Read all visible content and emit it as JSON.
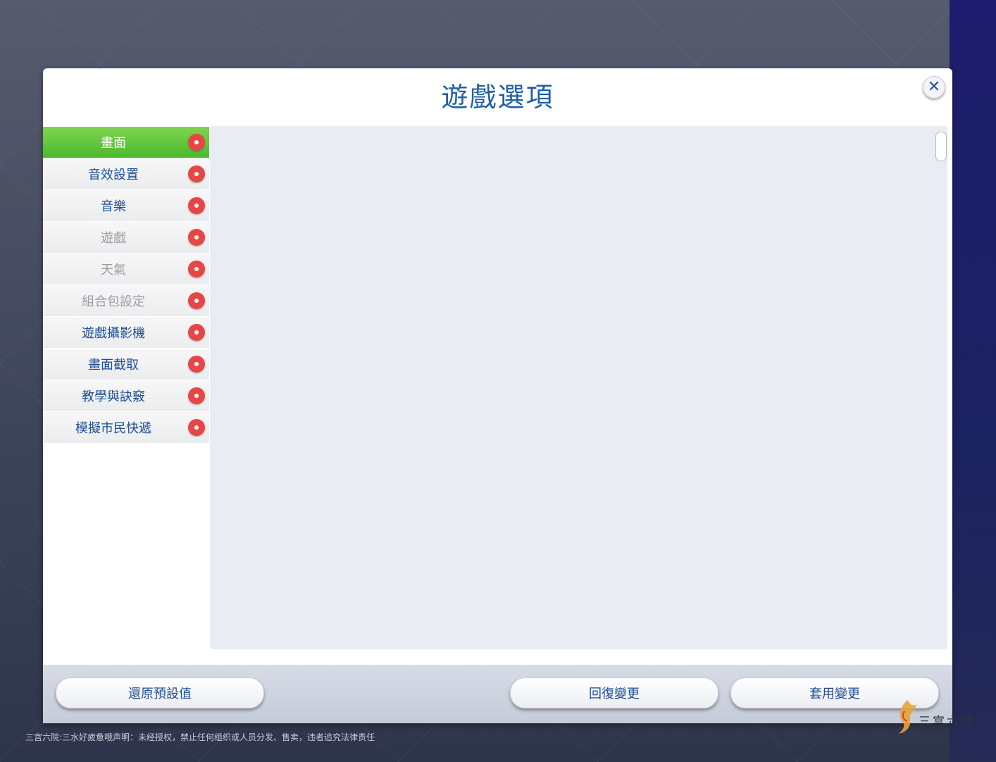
{
  "dialog": {
    "title": "遊戲選項",
    "close_icon": "close-icon"
  },
  "sidebar": {
    "items": [
      {
        "label": "畫面",
        "state": "active"
      },
      {
        "label": "音效設置",
        "state": "normal"
      },
      {
        "label": "音樂",
        "state": "normal"
      },
      {
        "label": "遊戲",
        "state": "dim"
      },
      {
        "label": "天氣",
        "state": "dim"
      },
      {
        "label": "組合包設定",
        "state": "dim"
      },
      {
        "label": "遊戲攝影機",
        "state": "normal"
      },
      {
        "label": "畫面截取",
        "state": "normal"
      },
      {
        "label": "教學與訣竅",
        "state": "normal"
      },
      {
        "label": "模擬市民快遞",
        "state": "normal"
      }
    ]
  },
  "footer": {
    "restore_defaults": "還原預設值",
    "revert_changes": "回復變更",
    "apply_changes": "套用變更"
  },
  "watermark": {
    "notice": "三宫六院:三水好疲惫哦声明：未经授权，禁止任何组织或人员分发、售卖，违者追究法律责任",
    "logo_text": "三宫六院"
  },
  "colors": {
    "accent_green": "#5cc23a",
    "title_blue": "#1f5fa7",
    "notification_red": "#e84646"
  }
}
